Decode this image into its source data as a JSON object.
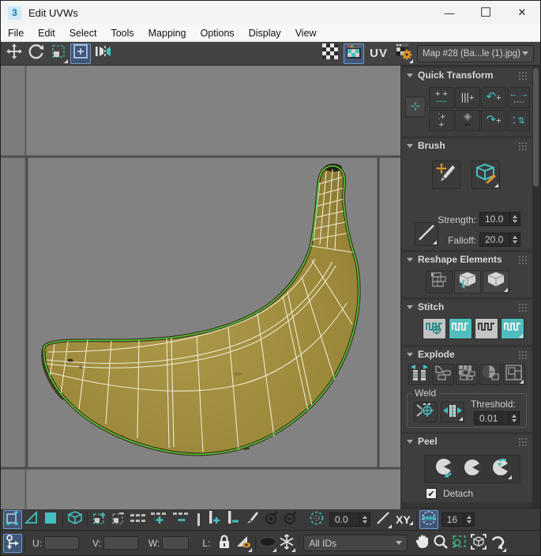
{
  "window": {
    "title": "Edit UVWs",
    "app_icon_glyph": "3",
    "minimize_glyph": "—",
    "maximize_glyph": "☐",
    "close_glyph": "✕"
  },
  "menu": {
    "items": [
      "File",
      "Edit",
      "Select",
      "Tools",
      "Mapping",
      "Options",
      "Display",
      "View"
    ]
  },
  "toolbar": {
    "uv_label": "UV",
    "map_dropdown_value": "Map #28 (Ba...le (1).jpg)"
  },
  "panels": {
    "quick_transform": {
      "title": "Quick Transform"
    },
    "brush": {
      "title": "Brush",
      "strength_label": "Strength:",
      "strength_value": "10.0",
      "falloff_label": "Falloff:",
      "falloff_value": "20.0"
    },
    "reshape": {
      "title": "Reshape Elements"
    },
    "stitch": {
      "title": "Stitch"
    },
    "explode": {
      "title": "Explode",
      "weld_label": "Weld",
      "threshold_label": "Threshold:",
      "threshold_value": "0.01"
    },
    "peel": {
      "title": "Peel",
      "detach_label": "Detach",
      "detach_check_glyph": "✔"
    }
  },
  "bottom_toolbar": {
    "soft_selection_value": "0.0",
    "axis_label": "XY",
    "edge_distance_value": "16"
  },
  "status_bar": {
    "u_label": "U:",
    "v_label": "V:",
    "w_label": "W:",
    "l_label": "L:",
    "u_value": "",
    "v_value": "",
    "w_value": "",
    "ids_dropdown_value": "All IDs"
  },
  "icons": {
    "qt_align_h": "++",
    "qt_align_v": "❘❘❘",
    "qt_rotate_ccw": "↶",
    "qt_space_h": "←→",
    "qt_align_v2": "⋮+",
    "qt_pelt": "◈",
    "qt_rotate_cw": "↷",
    "qt_space_v": "⇅"
  },
  "colors": {
    "accent_teal": "#45c0c0",
    "highlight_blue": "#41577a",
    "highlight_border": "#6d9bd3",
    "canvas_gray": "#828282",
    "grid_line": "#5e5e5e",
    "tile_border": "#4d4d4d",
    "banana_fill": "#a08c3e",
    "banana_edge_green": "#55c73e",
    "wireframe_white": "#f3eeda",
    "ui_dark": "#3a3a3a",
    "panel_bg": "#3e3e3e",
    "field_bg": "#2c2c2c",
    "text_light": "#d0d0d0",
    "orange_accent": "#d7952e"
  }
}
